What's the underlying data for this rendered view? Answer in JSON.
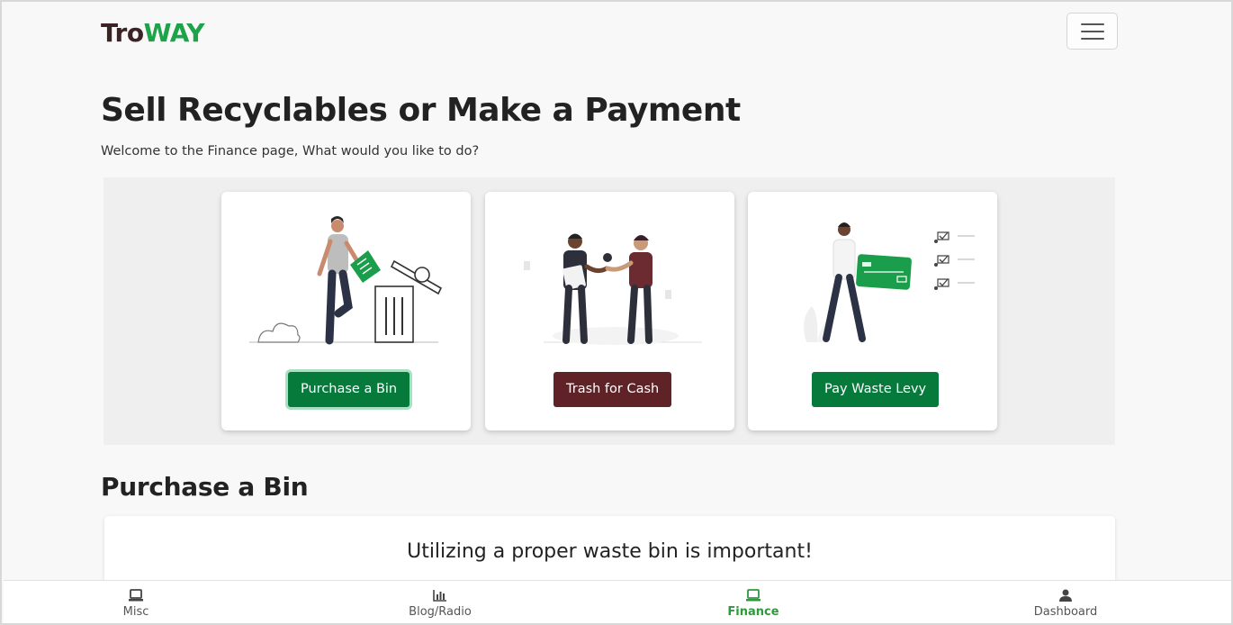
{
  "brand": {
    "part1": "Tro",
    "part2": "WAY"
  },
  "page": {
    "title": "Sell Recyclables or Make a Payment",
    "subtitle": "Welcome to the Finance page, What would you like to do?"
  },
  "cards": [
    {
      "label": "Purchase a Bin",
      "illustration": "person-trash-bin",
      "color": "#057a3a"
    },
    {
      "label": "Trash for Cash",
      "illustration": "handshake",
      "color": "#5e2227"
    },
    {
      "label": "Pay Waste Levy",
      "illustration": "person-credit-card-checklist",
      "color": "#057a3a"
    }
  ],
  "section": {
    "title": "Purchase a Bin",
    "card_heading": "Utilizing a proper waste bin is important!"
  },
  "bottom_nav": {
    "active": "Finance",
    "items": [
      {
        "label": "Misc",
        "icon": "laptop-icon"
      },
      {
        "label": "Blog/Radio",
        "icon": "bar-chart-icon"
      },
      {
        "label": "Finance",
        "icon": "laptop-icon"
      },
      {
        "label": "Dashboard",
        "icon": "user-icon"
      }
    ]
  },
  "colors": {
    "brand_dark": "#3b2325",
    "brand_green": "#1ea34a",
    "button_green": "#057a3a",
    "button_brown": "#5e2227",
    "nav_active": "#2e9a3c"
  }
}
